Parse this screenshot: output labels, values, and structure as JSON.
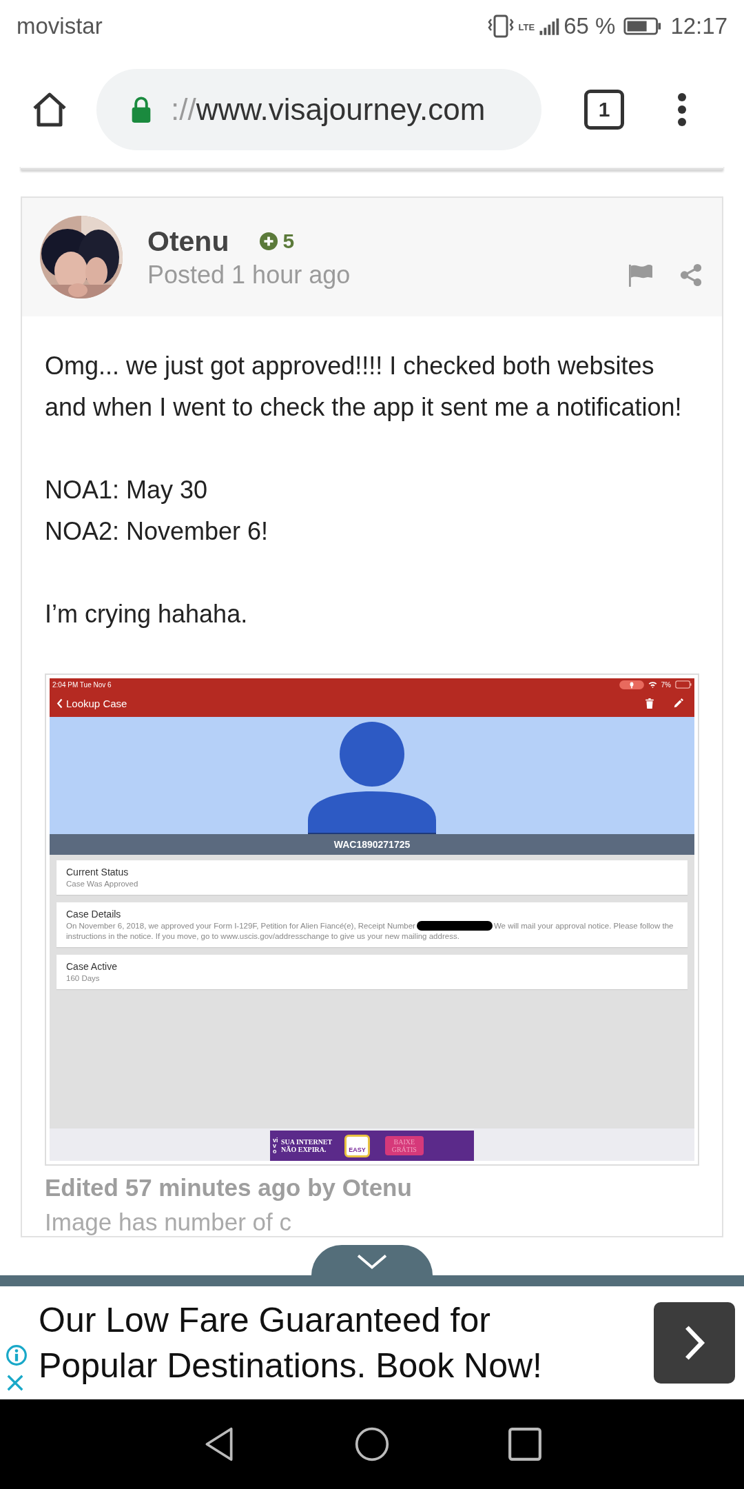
{
  "status_bar": {
    "carrier": "movistar",
    "network": "LTE",
    "battery": "65 %",
    "time": "12:17"
  },
  "browser": {
    "url_scheme": "://",
    "url_host": "www.visajourney.com",
    "tab_count": "1"
  },
  "post": {
    "author": "Otenu",
    "reputation": "5",
    "posted": "Posted 1 hour ago",
    "paragraphs": [
      {
        "lines": [
          "Omg... we just got approved!!!! I checked both websites and when I went to check the app it sent me a notification!"
        ]
      },
      {
        "lines": [
          "NOA1: May 30",
          "NOA2: November 6!"
        ]
      },
      {
        "lines": [
          "I’m crying hahaha."
        ]
      }
    ],
    "attachment": {
      "status_time": "2:04 PM   Tue Nov 6",
      "status_battery": "7%",
      "back_label": "Lookup Case",
      "receipt": "WAC1890271725",
      "cards": [
        {
          "title": "Current Status",
          "detail": "Case Was Approved",
          "redacted": false
        },
        {
          "title": "Case Details",
          "detail": "On November 6, 2018, we approved your Form I-129F, Petition for Alien Fiancé(e), Receipt Number",
          "redacted": true,
          "detail_after": "We will mail your approval notice. Please follow the instructions in the notice. If you move, go to www.uscis.gov/addresschange to give us your new mailing address."
        },
        {
          "title": "Case Active",
          "detail": "160 Days",
          "redacted": false
        }
      ],
      "banner": {
        "brand": "vivo",
        "headline": [
          "SUA INTERNET",
          "NÃO EXPIRA."
        ],
        "badge": "EASY",
        "cta": [
          "BAIXE",
          "GRÁTIS"
        ]
      }
    },
    "edited": "Edited 57 minutes ago by Otenu",
    "note": "Image has number of c"
  },
  "ad": {
    "lines": [
      "Our Low Fare Guaranteed for",
      "Popular Destinations. Book Now!"
    ]
  }
}
